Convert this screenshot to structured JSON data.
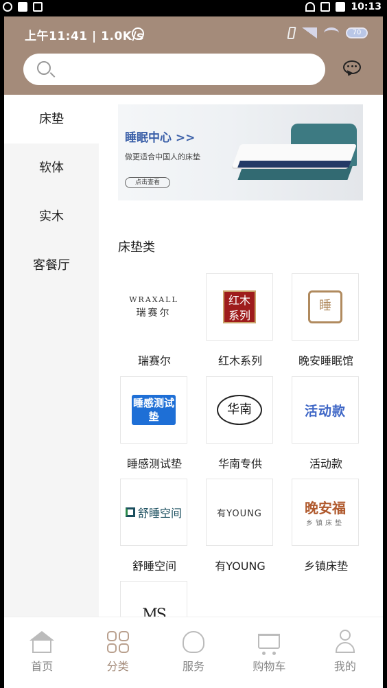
{
  "system_bar": {
    "time": "10:13"
  },
  "app_status": {
    "text": "上午11:41 | 1.0K/s",
    "battery": "70"
  },
  "search": {
    "placeholder": ""
  },
  "sidebar": {
    "items": [
      {
        "label": "床垫",
        "active": true
      },
      {
        "label": "软体",
        "active": false
      },
      {
        "label": "实木",
        "active": false
      },
      {
        "label": "客餐厅",
        "active": false
      }
    ]
  },
  "banner": {
    "title": "睡眠中心 >>",
    "subtitle": "做更适合中国人的床垫",
    "button": "点击查看"
  },
  "section": {
    "title": "床垫类"
  },
  "brands": [
    {
      "name": "瑞赛尔",
      "logo_text": "WRAXALL",
      "logo_sub": "瑞赛尔"
    },
    {
      "name": "红木系列",
      "logo_text": "红木系列"
    },
    {
      "name": "晚安睡眠馆",
      "logo_text": "睡"
    },
    {
      "name": "睡感测试垫",
      "logo_text": "睡感测试垫"
    },
    {
      "name": "华南专供",
      "logo_text": "华南"
    },
    {
      "name": "活动款",
      "logo_text": "活动款"
    },
    {
      "name": "舒睡空间",
      "logo_text": "舒睡空间"
    },
    {
      "name": "有YOUNG",
      "logo_text": "有YOUNG"
    },
    {
      "name": "乡镇床垫",
      "logo_text": "晚安福",
      "logo_sub": "乡镇床垫"
    },
    {
      "name": "",
      "logo_text": "MS"
    }
  ],
  "bottom_nav": {
    "items": [
      {
        "label": "首页",
        "icon": "home-icon"
      },
      {
        "label": "分类",
        "icon": "category-icon",
        "active": true
      },
      {
        "label": "服务",
        "icon": "service-icon"
      },
      {
        "label": "购物车",
        "icon": "cart-icon"
      },
      {
        "label": "我的",
        "icon": "user-icon"
      }
    ]
  },
  "colors": {
    "header": "#a48b7a",
    "accent": "#a48b7a",
    "sidebar_bg": "#f5f5f5"
  }
}
